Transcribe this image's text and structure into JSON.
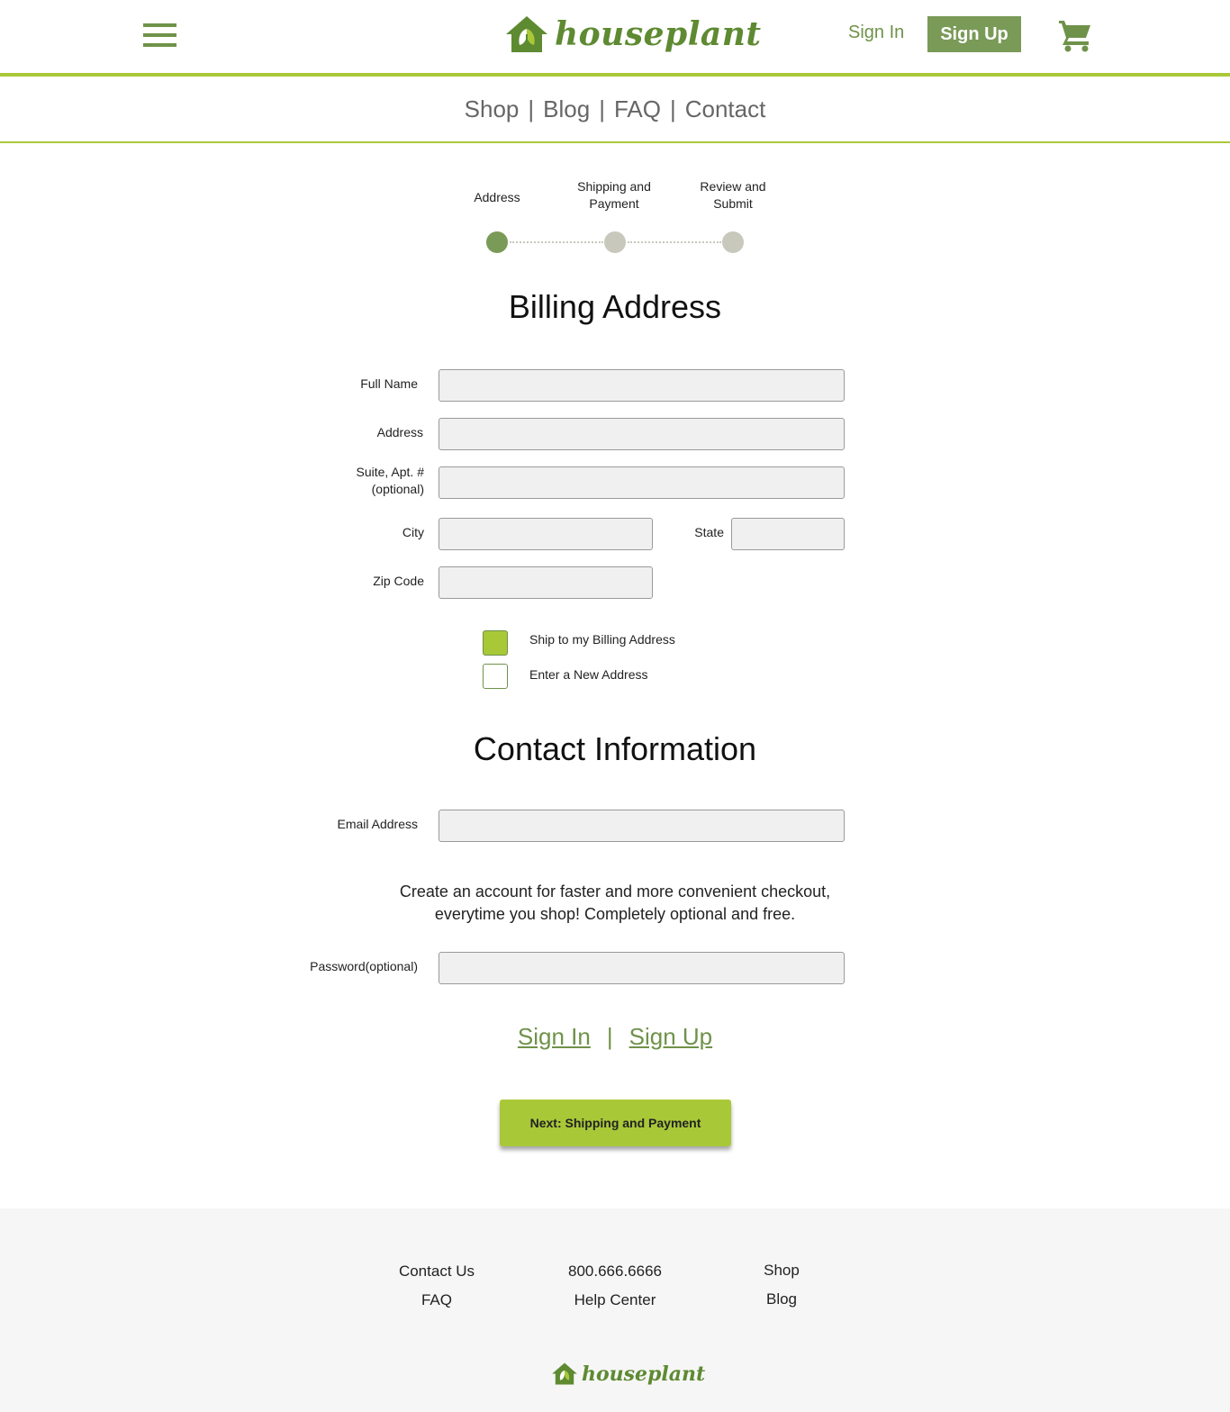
{
  "header": {
    "brand": "houseplant",
    "sign_in": "Sign In",
    "sign_up": "Sign Up"
  },
  "nav": {
    "items": [
      "Shop",
      "Blog",
      "FAQ",
      "Contact"
    ],
    "separator": "|"
  },
  "stepper": {
    "steps": [
      {
        "label": "Address"
      },
      {
        "label": "Shipping and Payment"
      },
      {
        "label": "Review and Submit"
      }
    ],
    "active_color": "#7a9a58",
    "inactive_color": "#c8c8bc"
  },
  "billing": {
    "title": "Billing Address",
    "full_name_label": "Full Name",
    "address_label": "Address",
    "suite_label_1": "Suite, Apt. #",
    "suite_label_2": "(optional)",
    "city_label": "City",
    "state_label": "State",
    "zip_label": "Zip Code",
    "ship_billing_label": "Ship to my Billing Address",
    "ship_billing_checked": true,
    "new_address_label": "Enter a New Address",
    "new_address_checked": false
  },
  "contact": {
    "title": "Contact Information",
    "email_label": "Email Address",
    "promo_line1": "Create an account for faster and more convenient checkout,",
    "promo_line2": "everytime you shop! Completely optional and free.",
    "password_label": "Password(optional)",
    "sign_in": "Sign In",
    "sign_up": "Sign Up",
    "separator": "|"
  },
  "next_button": "Next: Shipping and Payment",
  "footer": {
    "contact_us": "Contact Us",
    "faq": "FAQ",
    "phone": "800.666.6666",
    "help_center": "Help Center",
    "shop": "Shop",
    "blog": "Blog",
    "brand": "houseplant"
  },
  "colors": {
    "accent": "#a9c838",
    "brand_green": "#6f9249",
    "button_green": "#7a9a58"
  }
}
